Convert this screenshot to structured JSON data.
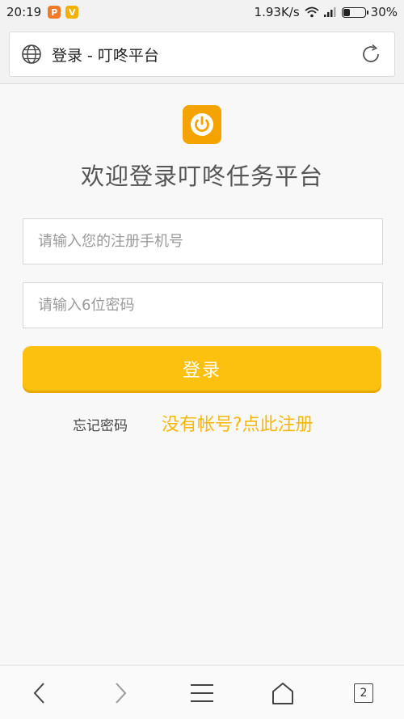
{
  "status_bar": {
    "time": "20:19",
    "network_speed": "1.93K/s",
    "battery_percent": "30%",
    "battery_level": 0.3,
    "app_icons": [
      "chat-notification-icon",
      "v-app-icon"
    ]
  },
  "browser": {
    "page_title": "登录 - 叮咚平台",
    "tab_count": "2"
  },
  "login": {
    "welcome": "欢迎登录叮咚任务平台",
    "phone_placeholder": "请输入您的注册手机号",
    "password_placeholder": "请输入6位密码",
    "login_button": "登录",
    "forgot_password": "忘记密码",
    "register_link": "没有帐号?点此注册"
  },
  "colors": {
    "accent": "#fcc00f",
    "logo": "#f5a300",
    "link": "#f5b70a"
  }
}
